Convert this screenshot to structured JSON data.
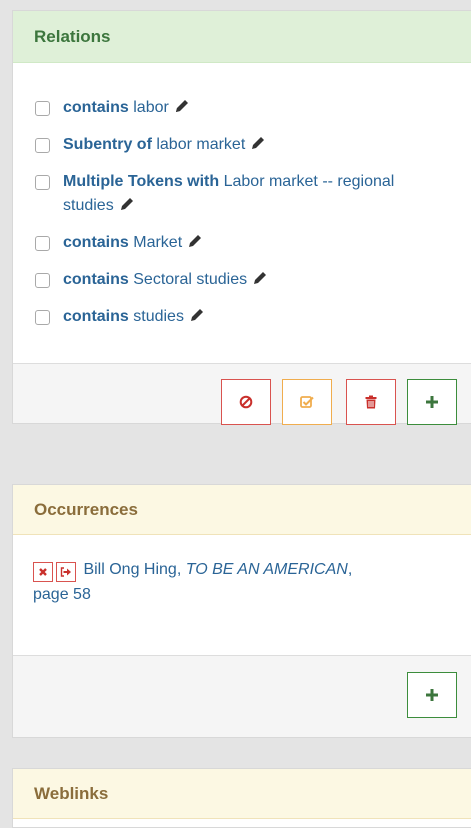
{
  "relations": {
    "title": "Relations",
    "items": [
      {
        "type": "contains",
        "target": "labor"
      },
      {
        "type": "Subentry of",
        "target": "labor market"
      },
      {
        "type": "Multiple Tokens with",
        "target": "Labor market -- regional studies"
      },
      {
        "type": "contains",
        "target": "Market"
      },
      {
        "type": "contains",
        "target": "Sectoral studies"
      },
      {
        "type": "contains",
        "target": "studies"
      }
    ],
    "footer_buttons": [
      "cancel-icon",
      "check-square-icon",
      "trash-icon",
      "plus-icon"
    ]
  },
  "occurrences": {
    "title": "Occurrences",
    "item": {
      "author": "Bill Ong Hing",
      "separator": ", ",
      "title": "TO BE AN AMERICAN",
      "comma": ",",
      "page": "page 58"
    }
  },
  "weblinks": {
    "title": "Weblinks"
  },
  "colors": {
    "relations_header_bg": "#dff0d8",
    "relations_header_text": "#3c763d",
    "occurrences_header_bg": "#fcf8e3",
    "occurrences_header_text": "#8a6d3b",
    "link": "#2a6496",
    "danger": "#c9302c",
    "warning": "#f0ad4e",
    "success": "#3c763d"
  }
}
